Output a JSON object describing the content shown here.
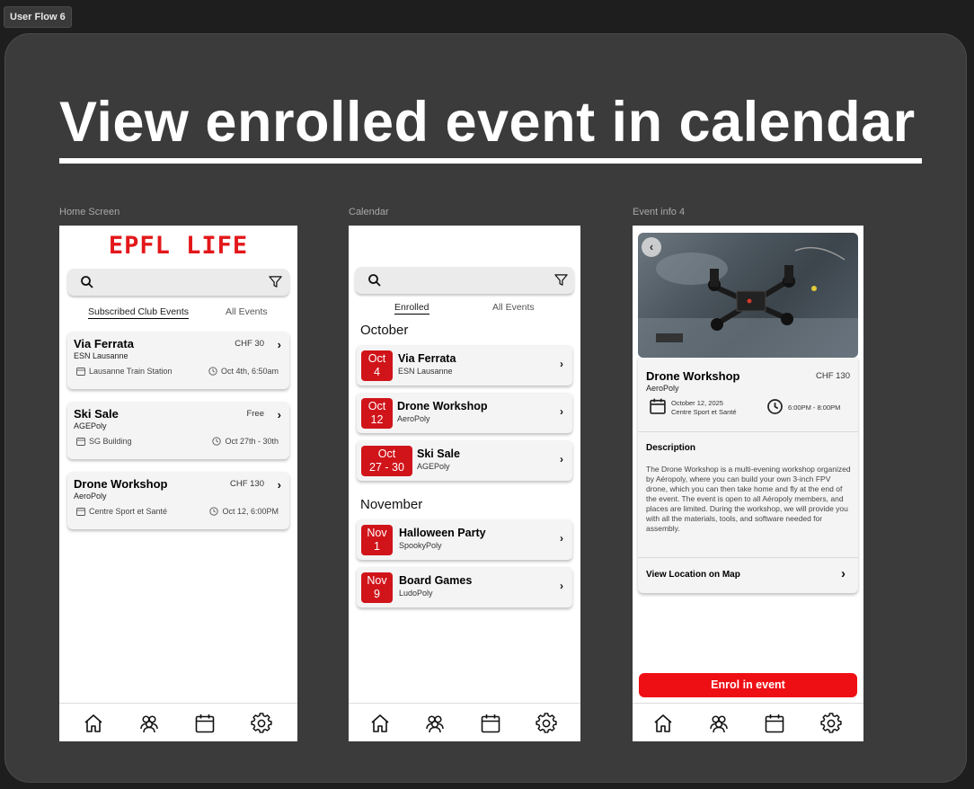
{
  "flow_tag": "User Flow 6",
  "board_title": "View enrolled event in calendar",
  "colors": {
    "brand_red": "#e3171a",
    "date_red": "#d0141a",
    "enrol_red": "#ee0f14",
    "board_bg": "#3c3b3b"
  },
  "screen1": {
    "label": "Home Screen",
    "logo": "EPFL LIFE",
    "tabs": [
      "Subscribed Club Events",
      "All Events"
    ],
    "events": [
      {
        "name": "Via Ferrata",
        "club": "ESN Lausanne",
        "price": "CHF 30",
        "location": "Lausanne Train Station",
        "time": "Oct 4th, 6:50am"
      },
      {
        "name": "Ski Sale",
        "club": "AGEPoly",
        "price": "Free",
        "location": "SG Building",
        "time": "Oct 27th - 30th"
      },
      {
        "name": "Drone Workshop",
        "club": "AeroPoly",
        "price": "CHF 130",
        "location": "Centre Sport et Santé",
        "time": "Oct 12, 6:00PM"
      }
    ]
  },
  "screen2": {
    "label": "Calendar",
    "tabs": [
      "Enrolled",
      "All Events"
    ],
    "months": [
      "October",
      "November"
    ],
    "october": [
      {
        "month": "Oct",
        "day": "4",
        "name": "Via Ferrata",
        "club": "ESN Lausanne"
      },
      {
        "month": "Oct",
        "day": "12",
        "name": "Drone Workshop",
        "club": "AeroPoly"
      },
      {
        "month": "Oct",
        "day": "27 - 30",
        "name": "Ski Sale",
        "club": "AGEPoly"
      }
    ],
    "november": [
      {
        "month": "Nov",
        "day": "1",
        "name": "Halloween Party",
        "club": "SpookyPoly"
      },
      {
        "month": "Nov",
        "day": "9",
        "name": "Board Games",
        "club": "LudoPoly"
      }
    ]
  },
  "screen3": {
    "label": "Event info 4",
    "name": "Drone Workshop",
    "club": "AeroPoly",
    "price": "CHF 130",
    "date": "October 12, 2025",
    "venue": "Centre Sport et Santé",
    "time": "6:00PM - 8:00PM",
    "description_heading": "Description",
    "description": "The Drone Workshop is a multi-evening workshop organized by Aéropoly, where you can build your own 3-inch FPV drone, which you can then take home and fly at the end of the event. The event is open to all Aéropoly members, and places are limited. During the workshop, we will provide you with all the materials, tools, and software needed for assembly.",
    "map_link": "View Location on Map",
    "enrol_button": "Enrol in event"
  },
  "nav_icons": [
    "home-icon",
    "clubs-icon",
    "calendar-icon",
    "settings-icon"
  ]
}
